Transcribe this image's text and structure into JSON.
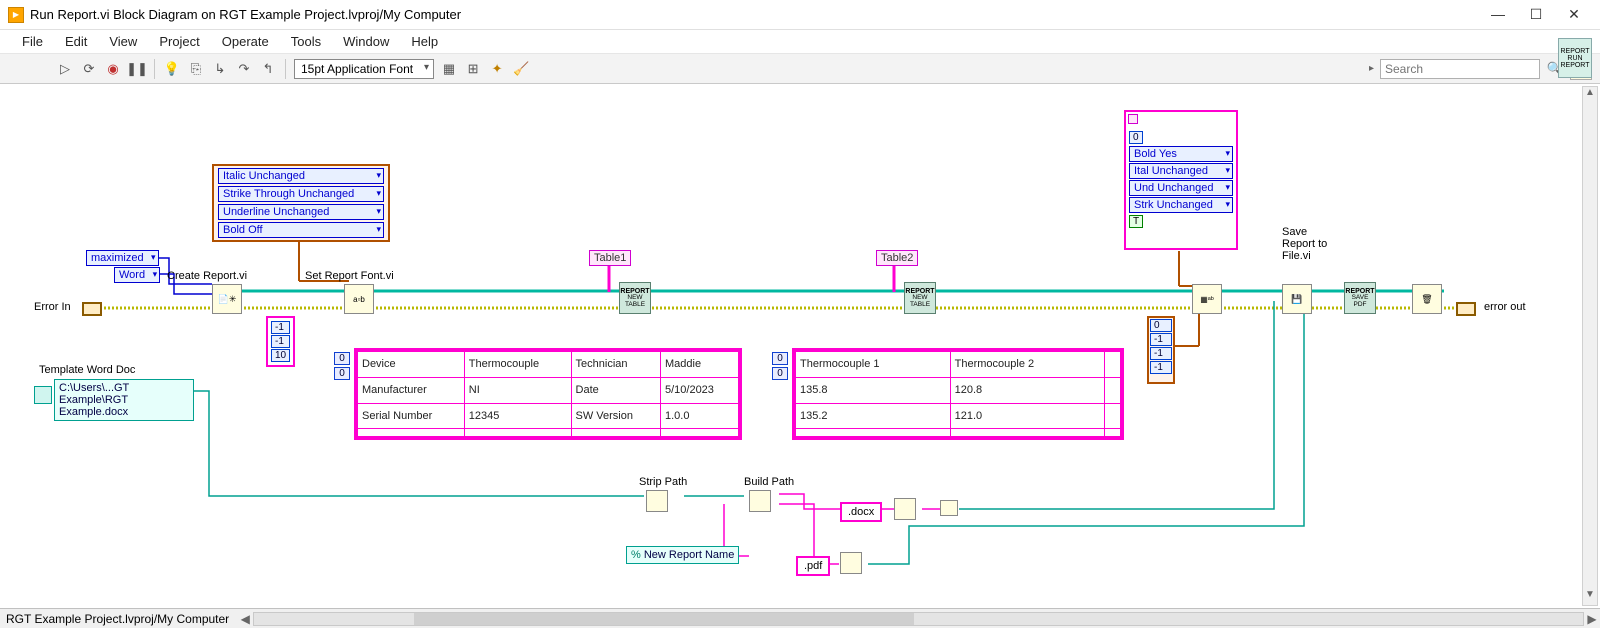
{
  "window": {
    "title": "Run Report.vi Block Diagram on RGT Example Project.lvproj/My Computer"
  },
  "menu": [
    "File",
    "Edit",
    "View",
    "Project",
    "Operate",
    "Tools",
    "Window",
    "Help"
  ],
  "toolbar": {
    "font": "15pt Application Font",
    "search_placeholder": "Search"
  },
  "status": {
    "path": "RGT Example Project.lvproj/My Computer"
  },
  "diagram": {
    "error_in": "Error In",
    "error_out": "error out",
    "maximized": "maximized",
    "word": "Word",
    "create_report": "Create Report.vi",
    "set_font": "Set Report Font.vi",
    "font_cluster": {
      "italic": "Italic Unchanged",
      "strike": "Strike Through Unchanged",
      "underline": "Underline Unchanged",
      "bold": "Bold Off"
    },
    "num_m1a": "-1",
    "num_m1b": "-1",
    "num_10": "10",
    "idx0a": "0",
    "idx0b": "0",
    "table1_label": "Table1",
    "table2_label": "Table2",
    "table1": {
      "r0": [
        "Device",
        "Thermocouple",
        "Technician",
        "Maddie"
      ],
      "r1": [
        "Manufacturer",
        "NI",
        "Date",
        "5/10/2023"
      ],
      "r2": [
        "Serial Number",
        "12345",
        "SW Version",
        "1.0.0"
      ]
    },
    "table2": {
      "h": [
        "Thermocouple 1",
        "Thermocouple 2"
      ],
      "r0": [
        "135.8",
        "120.8"
      ],
      "r1": [
        "135.2",
        "121.0"
      ]
    },
    "idx20": "0",
    "idx21": "0",
    "right_cluster": {
      "zero": "0",
      "bold": "Bold Yes",
      "italic": "Ital Unchanged",
      "underline": "Und Unchanged",
      "strike": "Strk Unchanged",
      "t": "T"
    },
    "right_nums": {
      "a": "0",
      "b": "-1",
      "c": "-1",
      "d": "-1"
    },
    "save_label": "Save Report to File.vi",
    "template_label": "Template Word Doc",
    "template_path": "C:\\Users\\...GT Example\\RGT Example.docx",
    "strip_path": "Strip Path",
    "build_path": "Build Path",
    "new_report_name": "New Report Name",
    "ext_docx": ".docx",
    "ext_pdf": ".pdf",
    "report_node_top": "REPORT",
    "new_table": "NEW TABLE",
    "save_pdf": "SAVE PDF",
    "run_report": "RUN REPORT"
  }
}
